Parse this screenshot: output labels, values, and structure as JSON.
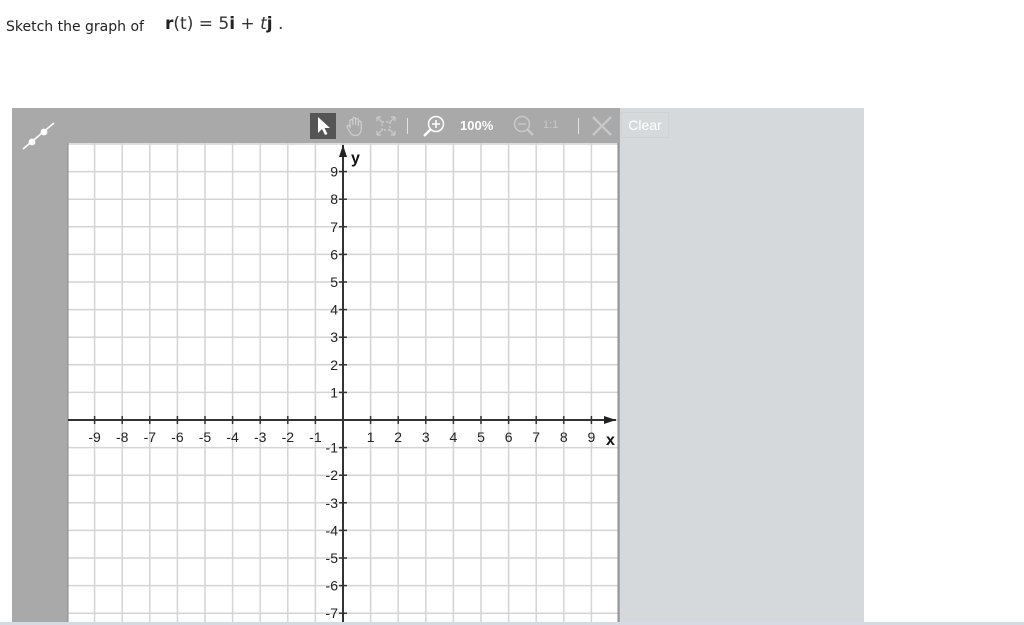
{
  "prompt": {
    "text": "Sketch the graph of",
    "formula": {
      "lhs_bold": "r",
      "lhs_arg": "(t)",
      "equals": " = 5",
      "i": "i",
      "plus": " + ",
      "t": "t",
      "j": "j",
      "end": " ."
    }
  },
  "left_tools": [
    {
      "name": "line-tool",
      "label": "Line"
    }
  ],
  "toolbar": {
    "tools": [
      "pointer",
      "pan",
      "fit-view",
      "zoom-in",
      "zoom-out",
      "reset-zoom",
      "delete"
    ],
    "zoom_level": "100%",
    "reset_label": "1:1",
    "clear_label": "Clear",
    "active_tool": "pointer"
  },
  "graph": {
    "x_label": "x",
    "y_label": "y",
    "x_ticks": [
      "-9",
      "-8",
      "-7",
      "-6",
      "-5",
      "-4",
      "-3",
      "-2",
      "-1",
      "1",
      "2",
      "3",
      "4",
      "5",
      "6",
      "7",
      "8",
      "9"
    ],
    "y_ticks": [
      "9",
      "8",
      "7",
      "6",
      "5",
      "4",
      "3",
      "2",
      "1",
      "-1",
      "-2",
      "-3",
      "-4",
      "-5",
      "-6",
      "-7"
    ],
    "x_range": [
      -10,
      10
    ],
    "y_range": [
      -7.3,
      10
    ],
    "grid": true
  }
}
